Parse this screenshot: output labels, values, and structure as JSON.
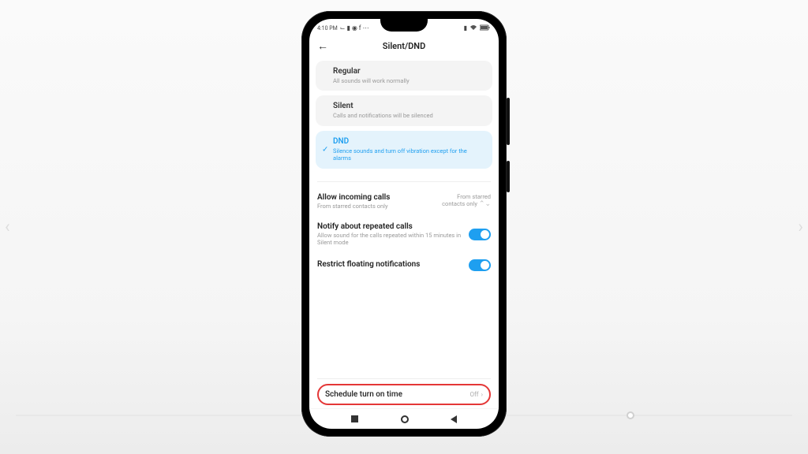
{
  "status": {
    "time": "4:10 PM",
    "icons_left": "⌙ ▮ ◉ f ⋯"
  },
  "page_title": "Silent/DND",
  "modes": [
    {
      "label": "Regular",
      "desc": "All sounds will work normally",
      "selected": false
    },
    {
      "label": "Silent",
      "desc": "Calls and notifications will be silenced",
      "selected": false
    },
    {
      "label": "DND",
      "desc": "Silence sounds and turn off vibration except for the alarms",
      "selected": true
    }
  ],
  "rows": {
    "incoming": {
      "label": "Allow incoming calls",
      "desc": "From starred contacts only",
      "value": "From starred\ncontacts only"
    },
    "repeated": {
      "label": "Notify about repeated calls",
      "desc": "Allow sound for the calls repeated within 15 minutes in Silent mode"
    },
    "restrict": {
      "label": "Restrict floating notifications"
    },
    "schedule": {
      "label": "Schedule turn on time",
      "value": "Off"
    }
  }
}
